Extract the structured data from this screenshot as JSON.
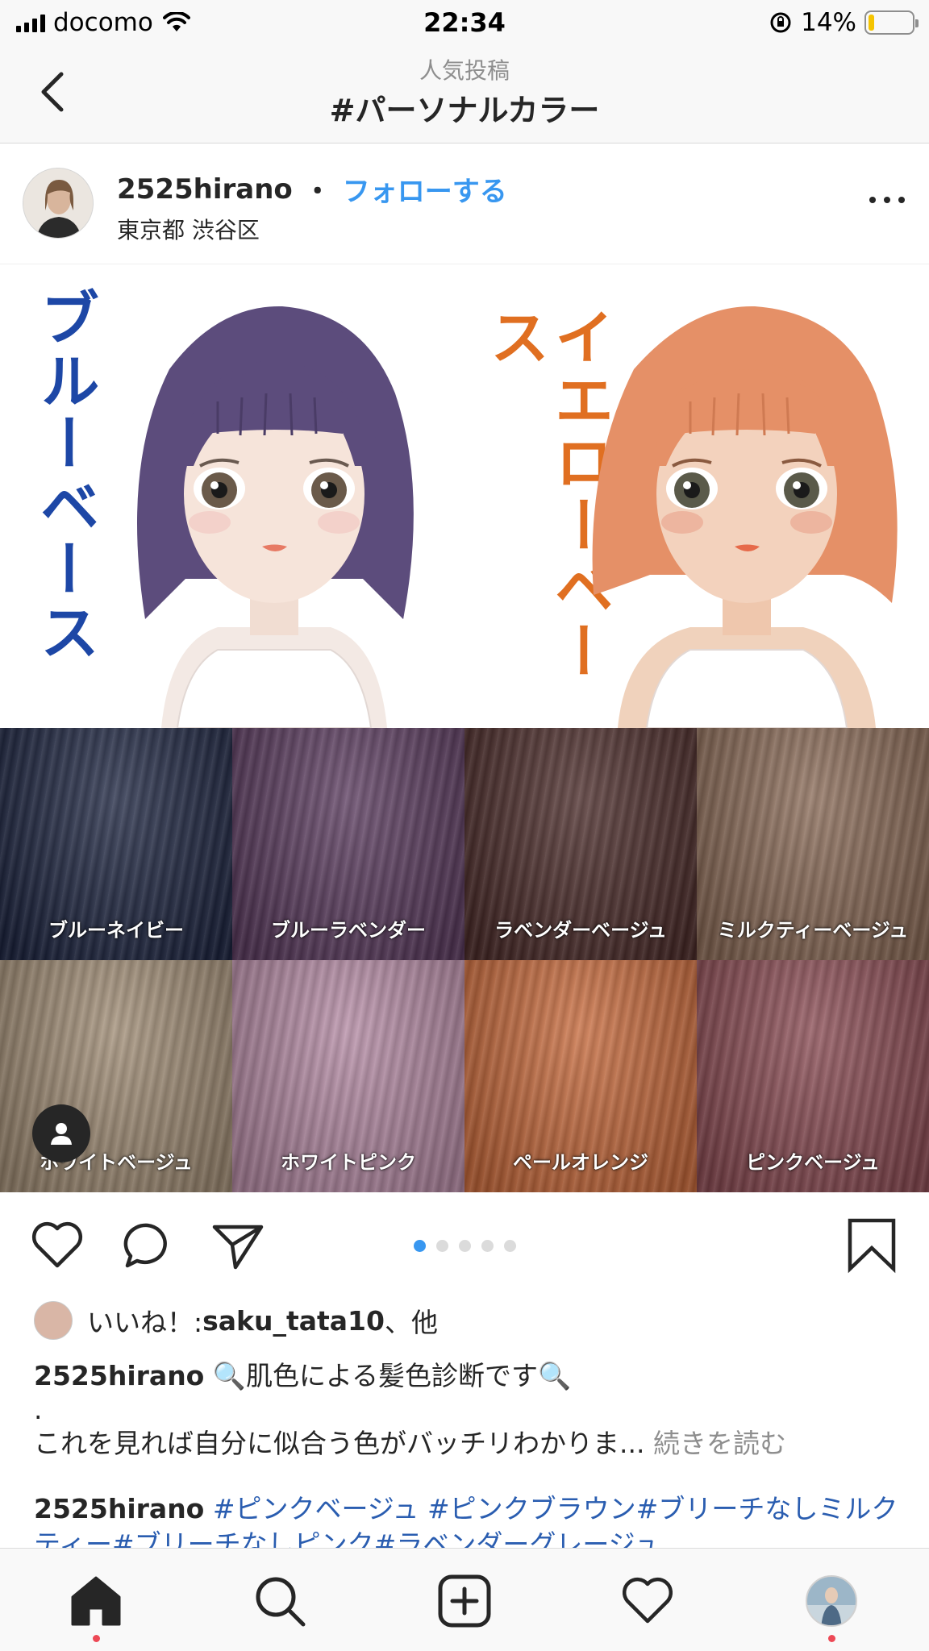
{
  "status_bar": {
    "carrier": "docomo",
    "time": "22:34",
    "battery": "14%",
    "battery_level": 0.14
  },
  "nav": {
    "subtitle": "人気投稿",
    "title": "#パーソナルカラー"
  },
  "post": {
    "username": "2525hirano",
    "separator": "・",
    "follow_label": "フォローする",
    "location": "東京都 渋谷区",
    "illustration": {
      "left_label": "ブルーベース",
      "right_label": "イエローベース"
    },
    "tiles": [
      {
        "label": "ブルーネイビー",
        "color": "#1c2440"
      },
      {
        "label": "ブルーラベンダー",
        "color": "#5a3a5e"
      },
      {
        "label": "ラベンダーベージュ",
        "color": "#4a2a28"
      },
      {
        "label": "ミルクティーベージュ",
        "color": "#8a6a56"
      },
      {
        "label": "ホワイトベージュ",
        "color": "#a08c74"
      },
      {
        "label": "ホワイトピンク",
        "color": "#b58aa4"
      },
      {
        "label": "ペールオレンジ",
        "color": "#c8693a"
      },
      {
        "label": "ピンクベージュ",
        "color": "#8a4a52"
      }
    ],
    "carousel": {
      "count": 5,
      "active": 0
    },
    "likes": {
      "prefix": "いいね！: ",
      "user": "saku_tata10",
      "suffix": "、他"
    },
    "caption": {
      "username": "2525hirano",
      "text": " 🔍肌色による髪色診断です🔍",
      "dot": ".",
      "line2": "これを見れば自分に似合う色がバッチリわかりま...",
      "more": " 続きを読む"
    },
    "comment": {
      "username": "2525hirano",
      "text": " #ピンクベージュ #ピンクブラウン#ブリーチなしミルクティー#ブリーチなしピンク#ラベンダーグレージュ"
    }
  },
  "tab_bar": {
    "items": [
      "home",
      "search",
      "new-post",
      "activity",
      "profile"
    ]
  }
}
